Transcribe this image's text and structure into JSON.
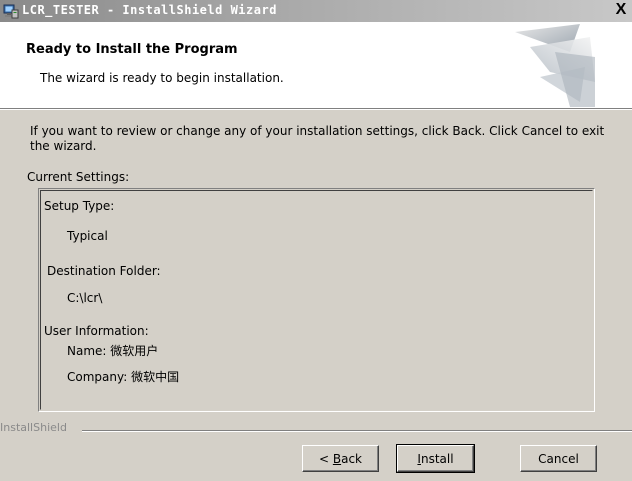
{
  "window": {
    "title": "LCR_TESTER - InstallShield Wizard",
    "close_glyph": "X"
  },
  "header": {
    "title": "Ready to Install the Program",
    "subtitle": "The wizard is ready to begin installation."
  },
  "body": {
    "intro": "If you want to review or change any of your installation settings, click Back. Click Cancel to exit the wizard.",
    "current_settings_label": "Current Settings:"
  },
  "settings": {
    "setup_type_label": "Setup Type:",
    "setup_type_value": "Typical",
    "destination_label": "Destination Folder:",
    "destination_value": "C:\\lcr\\",
    "user_info_label": "User Information:",
    "name_line": "Name: 微软用户",
    "company_line": "Company: 微软中国"
  },
  "footer": {
    "brand": "InstallShield",
    "back_prefix": "< ",
    "back_mnemonic": "B",
    "back_rest": "ack",
    "install_mnemonic": "I",
    "install_rest": "nstall",
    "cancel_label": "Cancel"
  },
  "colors": {
    "dialog_bg": "#d4d0c8",
    "header_bg": "#ffffff",
    "titlebar_inactive": "#a9a9a9"
  },
  "icons": {
    "app": "installer-computer-icon",
    "header": "installshield-abstract-graphic"
  }
}
